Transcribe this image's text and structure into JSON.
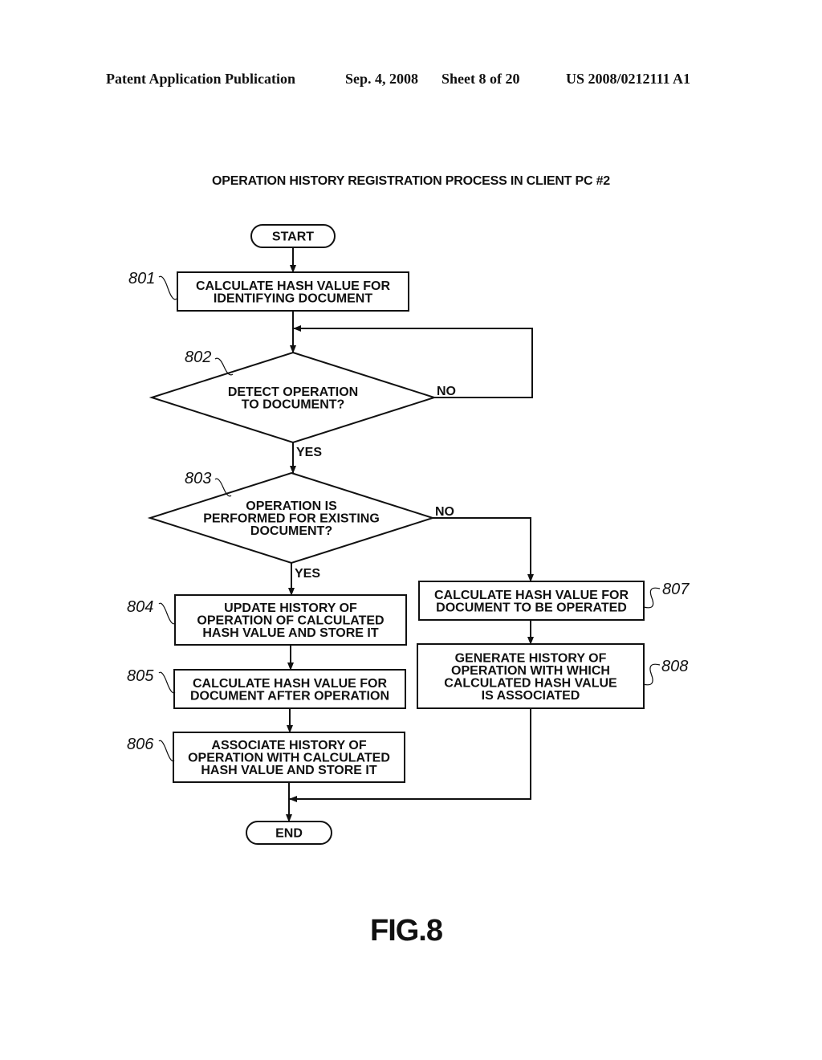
{
  "header": {
    "publication": "Patent Application Publication",
    "date": "Sep. 4, 2008",
    "sheet": "Sheet 8 of 20",
    "number": "US 2008/0212111 A1"
  },
  "diagram": {
    "title": "OPERATION HISTORY REGISTRATION PROCESS IN CLIENT PC  #2",
    "figure_label": "FIG.8",
    "nodes": {
      "start": {
        "type": "terminal",
        "lines": [
          "START"
        ]
      },
      "n801": {
        "type": "process",
        "ref": "801",
        "lines": [
          "CALCULATE HASH VALUE FOR",
          "IDENTIFYING DOCUMENT"
        ]
      },
      "n802": {
        "type": "decision",
        "ref": "802",
        "lines": [
          "DETECT OPERATION",
          "TO DOCUMENT?"
        ]
      },
      "n803": {
        "type": "decision",
        "ref": "803",
        "lines": [
          "OPERATION IS",
          "PERFORMED FOR EXISTING",
          "DOCUMENT?"
        ]
      },
      "n804": {
        "type": "process",
        "ref": "804",
        "lines": [
          "UPDATE HISTORY OF",
          "OPERATION OF CALCULATED",
          "HASH VALUE AND STORE IT"
        ]
      },
      "n805": {
        "type": "process",
        "ref": "805",
        "lines": [
          "CALCULATE HASH VALUE FOR",
          "DOCUMENT AFTER OPERATION"
        ]
      },
      "n806": {
        "type": "process",
        "ref": "806",
        "lines": [
          "ASSOCIATE HISTORY OF",
          "OPERATION WITH CALCULATED",
          "HASH VALUE AND STORE IT"
        ]
      },
      "n807": {
        "type": "process",
        "ref": "807",
        "lines": [
          "CALCULATE HASH VALUE FOR",
          "DOCUMENT TO BE OPERATED"
        ]
      },
      "n808": {
        "type": "process",
        "ref": "808",
        "lines": [
          "GENERATE HISTORY OF",
          "OPERATION WITH WHICH",
          "CALCULATED HASH VALUE",
          "IS ASSOCIATED"
        ]
      },
      "end": {
        "type": "terminal",
        "lines": [
          "END"
        ]
      }
    },
    "edges": [
      {
        "from": "start",
        "to": "n801",
        "label": ""
      },
      {
        "from": "n801",
        "to": "n802",
        "label": ""
      },
      {
        "from": "n802",
        "to": "n802",
        "label": "NO"
      },
      {
        "from": "n802",
        "to": "n803",
        "label": "YES"
      },
      {
        "from": "n803",
        "to": "n804",
        "label": "YES"
      },
      {
        "from": "n803",
        "to": "n807",
        "label": "NO"
      },
      {
        "from": "n804",
        "to": "n805",
        "label": ""
      },
      {
        "from": "n805",
        "to": "n806",
        "label": ""
      },
      {
        "from": "n806",
        "to": "end",
        "label": ""
      },
      {
        "from": "n807",
        "to": "n808",
        "label": ""
      },
      {
        "from": "n808",
        "to": "end",
        "label": ""
      }
    ]
  }
}
